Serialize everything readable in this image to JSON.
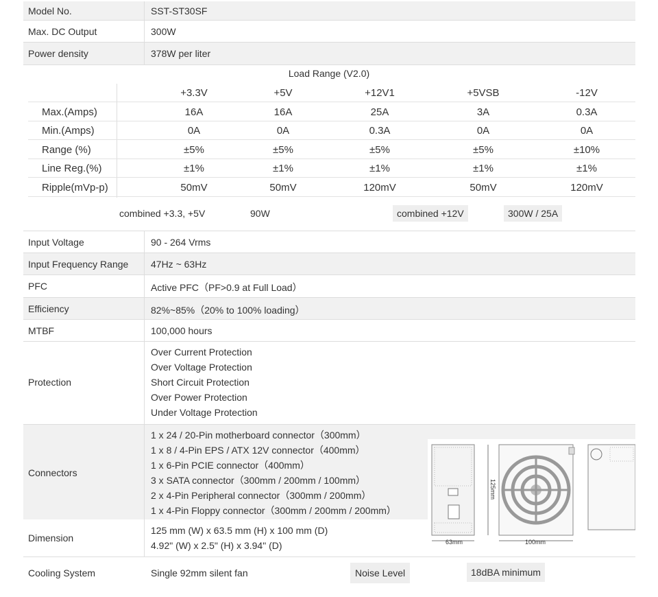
{
  "specs_top": [
    {
      "label": "Model No.",
      "value": "SST-ST30SF"
    },
    {
      "label": "Max. DC Output",
      "value": "300W"
    },
    {
      "label": "Power density",
      "value": "378W per liter"
    }
  ],
  "load_range": {
    "title": "Load Range (V2.0)",
    "columns": [
      "+3.3V",
      "+5V",
      "+12V1",
      "+5VSB",
      "-12V"
    ],
    "rows": [
      {
        "label": "Max.(Amps)",
        "values": [
          "16A",
          "16A",
          "25A",
          "3A",
          "0.3A"
        ]
      },
      {
        "label": "Min.(Amps)",
        "values": [
          "0A",
          "0A",
          "0.3A",
          "0A",
          "0A"
        ]
      },
      {
        "label": "Range (%)",
        "values": [
          "±5%",
          "±5%",
          "±5%",
          "±5%",
          "±10%"
        ]
      },
      {
        "label": "Line Reg.(%)",
        "values": [
          "±1%",
          "±1%",
          "±1%",
          "±1%",
          "±1%"
        ]
      },
      {
        "label": "Ripple(mVp-p)",
        "values": [
          "50mV",
          "50mV",
          "120mV",
          "50mV",
          "120mV"
        ]
      }
    ],
    "combined_low_label": "combined +3.3, +5V",
    "combined_low_value": "90W",
    "combined_high_label": "combined +12V",
    "combined_high_value": "300W / 25A"
  },
  "specs_bottom": [
    {
      "label": "Input Voltage",
      "value": "90 - 264 Vrms"
    },
    {
      "label": "Input Frequency Range",
      "value": "47Hz ~ 63Hz"
    },
    {
      "label": "PFC",
      "value": "Active PFC（PF>0.9 at Full Load）"
    },
    {
      "label": "Efficiency",
      "value": "82%~85%（20% to 100% loading）"
    },
    {
      "label": "MTBF",
      "value": "100,000 hours"
    }
  ],
  "protection": {
    "label": "Protection",
    "items": [
      "Over Current Protection",
      "Over Voltage Protection",
      "Short Circuit Protection",
      "Over Power Protection",
      "Under Voltage Protection"
    ]
  },
  "connectors": {
    "label": "Connectors",
    "items": [
      "1 x 24 / 20-Pin motherboard connector（300mm）",
      "1 x 8 / 4-Pin EPS / ATX 12V connector（400mm）",
      "1 x 6-Pin PCIE connector（400mm）",
      "3 x SATA connector（300mm / 200mm / 100mm）",
      "2 x 4-Pin Peripheral connector（300mm / 200mm）",
      "1 x 4-Pin Floppy connector（300mm / 200mm / 200mm）"
    ]
  },
  "dimension": {
    "label": "Dimension",
    "lines": [
      "125 mm (W) x 63.5 mm (H) x 100 mm (D)",
      "4.92\" (W) x 2.5\" (H) x 3.94\" (D)"
    ],
    "diagram_labels": {
      "height": "125mm",
      "width": "63mm",
      "depth": "100mm"
    }
  },
  "cooling": {
    "label": "Cooling System",
    "value": "Single 92mm silent fan",
    "noise_label": "Noise Level",
    "noise_value": "18dBA minimum"
  }
}
